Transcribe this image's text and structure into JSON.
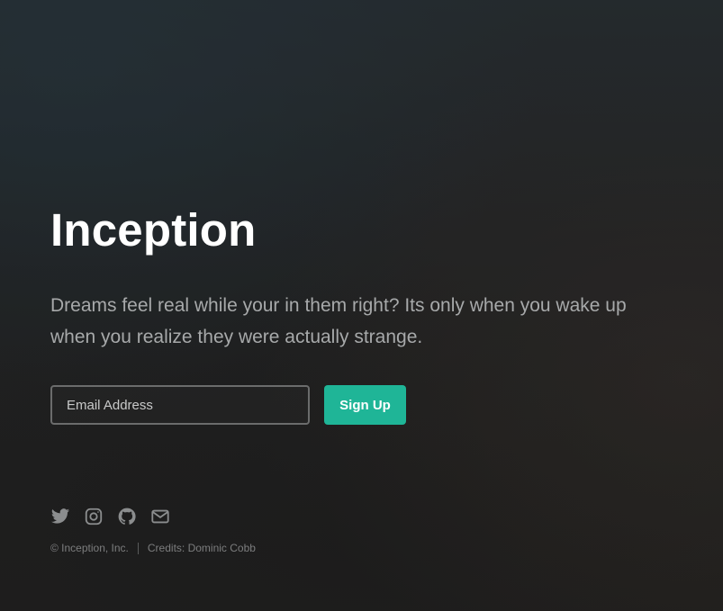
{
  "hero": {
    "title": "Inception",
    "description": "Dreams feel real while your in them right? Its only when you wake up when you realize they were actually strange."
  },
  "signup_form": {
    "email_placeholder": "Email Address",
    "email_value": "",
    "submit_label": "Sign Up"
  },
  "social": {
    "icons": [
      "twitter-icon",
      "instagram-icon",
      "github-icon",
      "mail-icon"
    ]
  },
  "footer": {
    "copyright": "© Inception, Inc.",
    "credits": "Credits: Dominic Cobb"
  },
  "colors": {
    "accent": "#1fb597",
    "text_primary": "#ffffff",
    "text_muted": "#a7a9aa",
    "icon_gray": "#8b8d8e"
  }
}
